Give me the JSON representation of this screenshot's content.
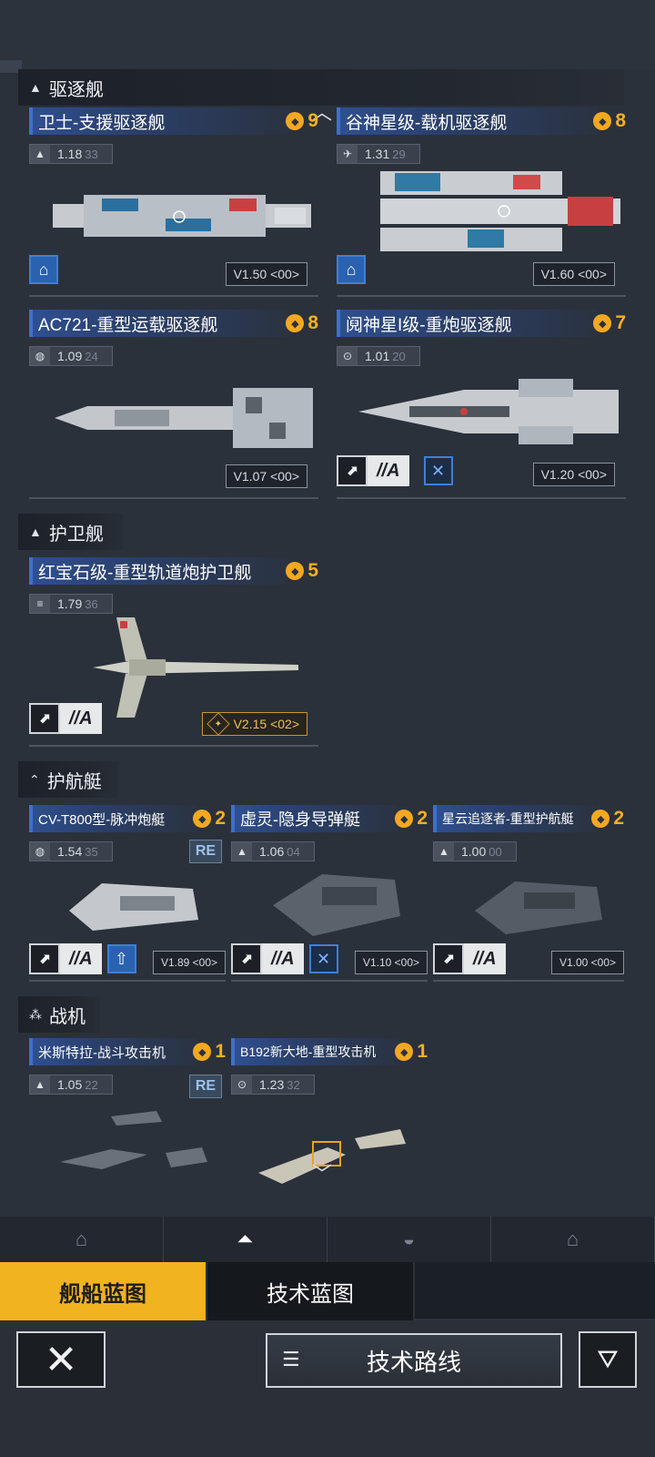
{
  "sections": {
    "destroyer": "驱逐舰",
    "frigate": "护卫舰",
    "corvette": "护航艇",
    "fighter": "战机"
  },
  "ships": [
    {
      "name": "卫士-支援驱逐舰",
      "cost": "9",
      "stat_main": "1.18",
      "stat_sub": "33",
      "version": "V1.50  <00>"
    },
    {
      "name": "谷神星级-载机驱逐舰",
      "cost": "8",
      "stat_main": "1.31",
      "stat_sub": "29",
      "version": "V1.60  <00>"
    },
    {
      "name": "AC721-重型运载驱逐舰",
      "cost": "8",
      "stat_main": "1.09",
      "stat_sub": "24",
      "version": "V1.07  <00>"
    },
    {
      "name": "阋神星I级-重炮驱逐舰",
      "cost": "7",
      "stat_main": "1.01",
      "stat_sub": "20",
      "version": "V1.20  <00>",
      "rank": "//A"
    },
    {
      "name": "红宝石级-重型轨道炮护卫舰",
      "cost": "5",
      "stat_main": "1.79",
      "stat_sub": "36",
      "version": "V2.15  <02>",
      "rank": "//A"
    },
    {
      "name": "CV-T800型-脉冲炮艇",
      "cost": "2",
      "stat_main": "1.54",
      "stat_sub": "35",
      "version": "V1.89  <00>",
      "rank": "//A",
      "badge": "RE"
    },
    {
      "name": "虚灵-隐身导弹艇",
      "cost": "2",
      "stat_main": "1.06",
      "stat_sub": "04",
      "version": "V1.10  <00>",
      "rank": "//A"
    },
    {
      "name": "星云追逐者-重型护航艇",
      "cost": "2",
      "stat_main": "1.00",
      "stat_sub": "00",
      "version": "V1.00  <00>",
      "rank": "//A"
    },
    {
      "name": "米斯特拉-战斗攻击机",
      "cost": "1",
      "stat_main": "1.05",
      "stat_sub": "22",
      "badge": "RE"
    },
    {
      "name": "B192新大地-重型攻击机",
      "cost": "1",
      "stat_main": "1.23",
      "stat_sub": "32"
    }
  ],
  "tabs": {
    "ship_blueprint": "舰船蓝图",
    "tech_blueprint": "技术蓝图"
  },
  "buttons": {
    "tech_route": "技术路线"
  },
  "colors": {
    "accent": "#f1b320",
    "title_bar": "#2f4f8f",
    "cost": "#f4b020"
  }
}
